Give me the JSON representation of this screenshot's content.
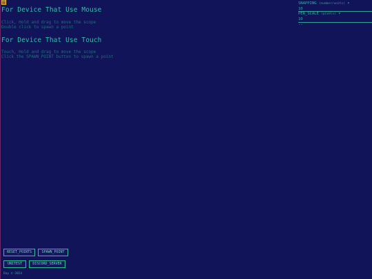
{
  "mouse": {
    "heading": "For Device That Use Mouse",
    "line1": "Click, Hold and drag to move the scope",
    "line2": "Double click to spawn a point"
  },
  "touch": {
    "heading": "For Device That Use Touch",
    "line1": "Touch, Hold and drag to move the scope",
    "line2": "Click the SPAWN_POINT button to spawn a point"
  },
  "settings": {
    "snapping_label": "SNAPPING",
    "snapping_hint": "(number/units)",
    "snapping_caret": "▾",
    "snapping_value": "10",
    "per_scale_label": "PER_SCALE",
    "per_scale_hint": "(pixels)",
    "per_scale_caret": "▾",
    "per_scale_value": "10",
    "extra_value": "--"
  },
  "buttons": {
    "reset_points": "RESET_POINTS",
    "spawn_point": "SPAWN_POINT",
    "unitest": "UNITEST",
    "discord_server": "DISCORD_SERVER"
  },
  "footer": "Day © 2024",
  "colors": {
    "background": "#12145a",
    "accent": "#2fc0a4",
    "dim_text": "#1f6f7a",
    "menu_icon": "#f2c14e"
  }
}
